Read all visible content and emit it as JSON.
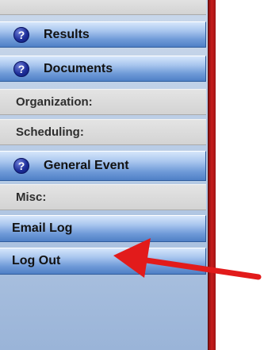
{
  "sidebar": {
    "results_label": "Results",
    "documents_label": "Documents",
    "organization_label": "Organization:",
    "scheduling_label": "Scheduling:",
    "general_event_label": "General Event",
    "misc_label": "Misc:",
    "email_log_label": "Email Log",
    "log_out_label": "Log Out"
  },
  "icons": {
    "help": "question-mark-icon",
    "pointer": "red-arrow-annotation"
  },
  "colors": {
    "nav_blue": "#6f9ad8",
    "section_gray": "#d3d3d3",
    "divider_red": "#c81d1d",
    "arrow_red": "#e21b1b",
    "help_icon": "#1e2f9a"
  }
}
